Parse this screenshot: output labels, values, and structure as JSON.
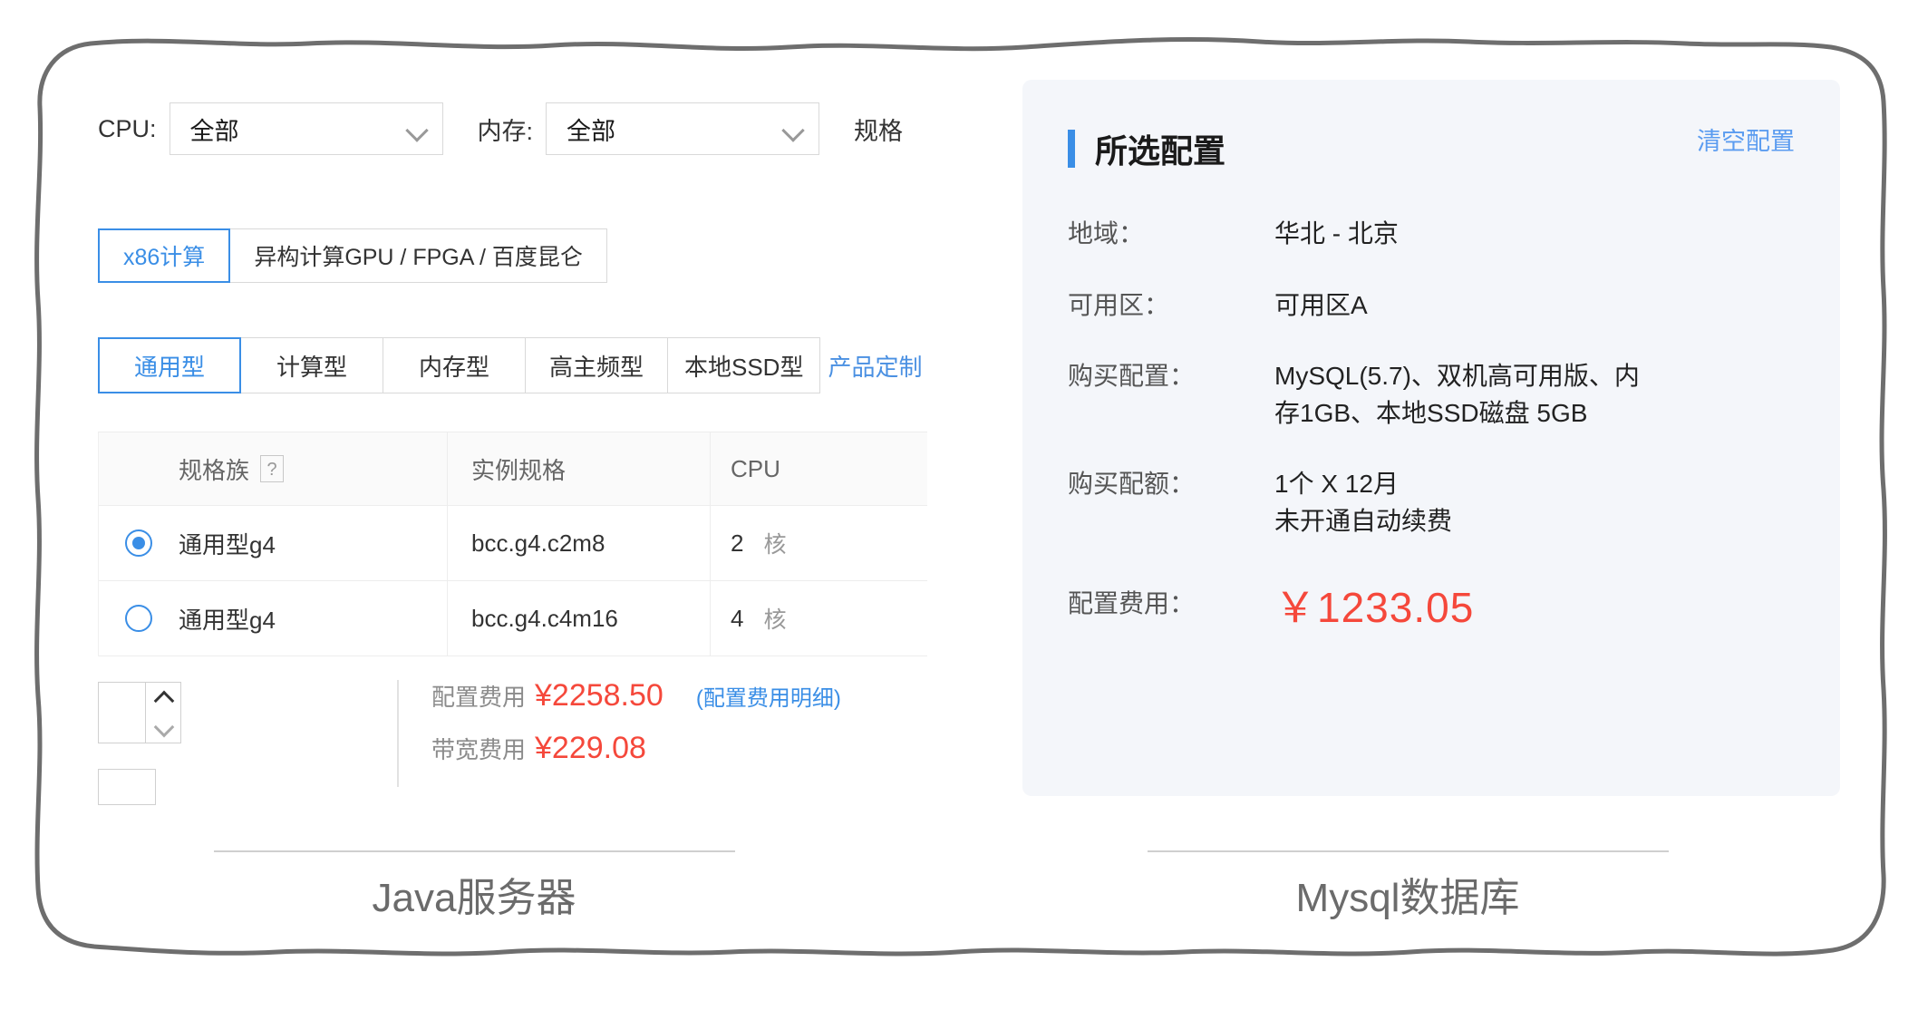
{
  "left_panel": {
    "filters": [
      {
        "label": "CPU:",
        "value": "全部",
        "icon": "chevron-down-icon"
      },
      {
        "label": "内存:",
        "value": "全部",
        "icon": "chevron-down-icon"
      }
    ],
    "trailing_label": "规格",
    "compute_types": [
      {
        "label": "x86计算",
        "active": true
      },
      {
        "label": "异构计算GPU / FPGA / 百度昆仑",
        "active": false
      }
    ],
    "category_tabs": [
      {
        "label": "通用型",
        "active": true
      },
      {
        "label": "计算型",
        "active": false
      },
      {
        "label": "内存型",
        "active": false
      },
      {
        "label": "高主频型",
        "active": false
      },
      {
        "label": "本地SSD型",
        "active": false
      }
    ],
    "custom_link": "产品定制",
    "table": {
      "headers": {
        "family": "规格族",
        "family_help": "?",
        "spec": "实例规格",
        "cpu": "CPU"
      },
      "rows": [
        {
          "selected": true,
          "family": "通用型g4",
          "spec": "bcc.g4.c2m8",
          "cpu": "2",
          "cpu_unit": "核"
        },
        {
          "selected": false,
          "family": "通用型g4",
          "spec": "bcc.g4.c4m16",
          "cpu": "4",
          "cpu_unit": "核"
        }
      ]
    },
    "fees": [
      {
        "label": "配置费用",
        "amount": "¥2258.50",
        "detail_link": "(配置费用明细)"
      },
      {
        "label": "带宽费用",
        "amount": "¥229.08",
        "detail_link": ""
      }
    ]
  },
  "right_panel": {
    "title": "所选配置",
    "clear_label": "清空配置",
    "items": [
      {
        "key": "地域：",
        "value": "华北 - 北京",
        "value2": ""
      },
      {
        "key": "可用区：",
        "value": "可用区A",
        "value2": ""
      },
      {
        "key": "购买配置：",
        "value": "MySQL(5.7)、双机高可用版、内存1GB、本地SSD磁盘 5GB",
        "value2": ""
      },
      {
        "key": "购买配额：",
        "value": "1个 X 12月",
        "value2": "未开通自动续费"
      }
    ],
    "price_label": "配置费用：",
    "price_value": "￥1233.05"
  },
  "captions": {
    "left": "Java服务器",
    "right": "Mysql数据库"
  },
  "colors": {
    "accent_blue": "#3a8ee6",
    "link_blue": "#5b9cf0",
    "price_red": "#f5483b",
    "panel_bg": "#f4f6fa",
    "frame_stroke": "#6e6e6e"
  }
}
